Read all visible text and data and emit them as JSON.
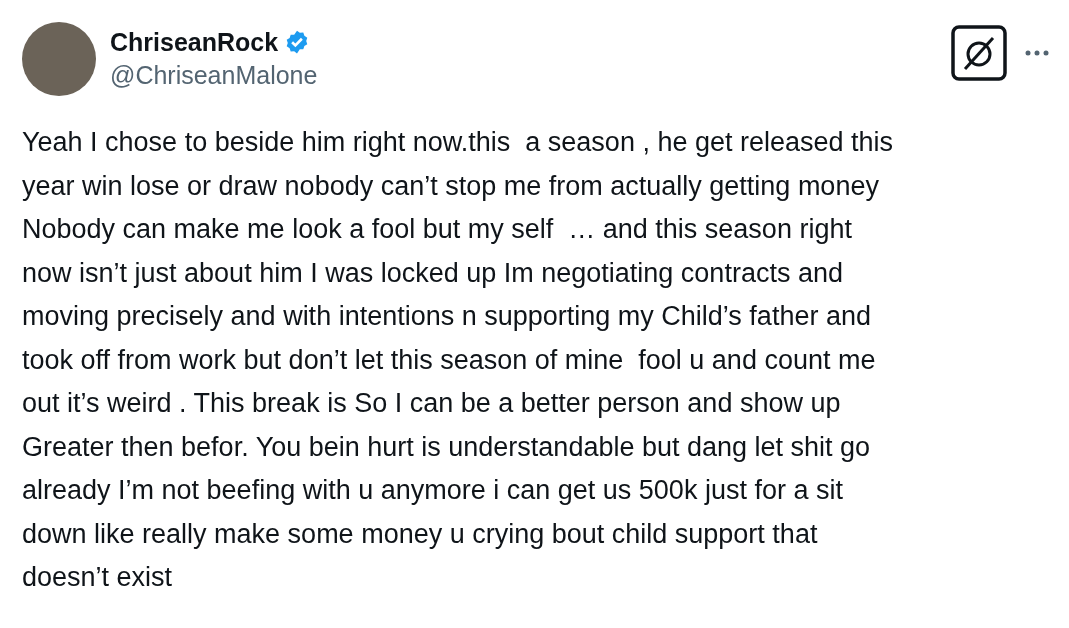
{
  "author": {
    "name": "ChriseanRock",
    "verified": true,
    "handle": "@ChriseanMalone"
  },
  "post": {
    "lines": [
      "Yeah I chose to beside him right now.this  a season , he get released this",
      "year win lose or draw nobody can’t stop me from actually getting money",
      "Nobody can make me look a fool but my self  … and this season right",
      "now isn’t just about him I was locked up Im negotiating contracts and",
      "moving precisely and with intentions n supporting my Child’s father and",
      "took off from work but don’t let this season of mine  fool u and count me",
      "out it’s weird . This break is So I can be a better person and show up",
      "Greater then befor. You bein hurt is understandable but dang let shit go",
      "already I’m not beefing with u anymore i can get us 500k just for a sit",
      "down like really make some money u crying bout child support that",
      "doesn’t exist"
    ]
  }
}
